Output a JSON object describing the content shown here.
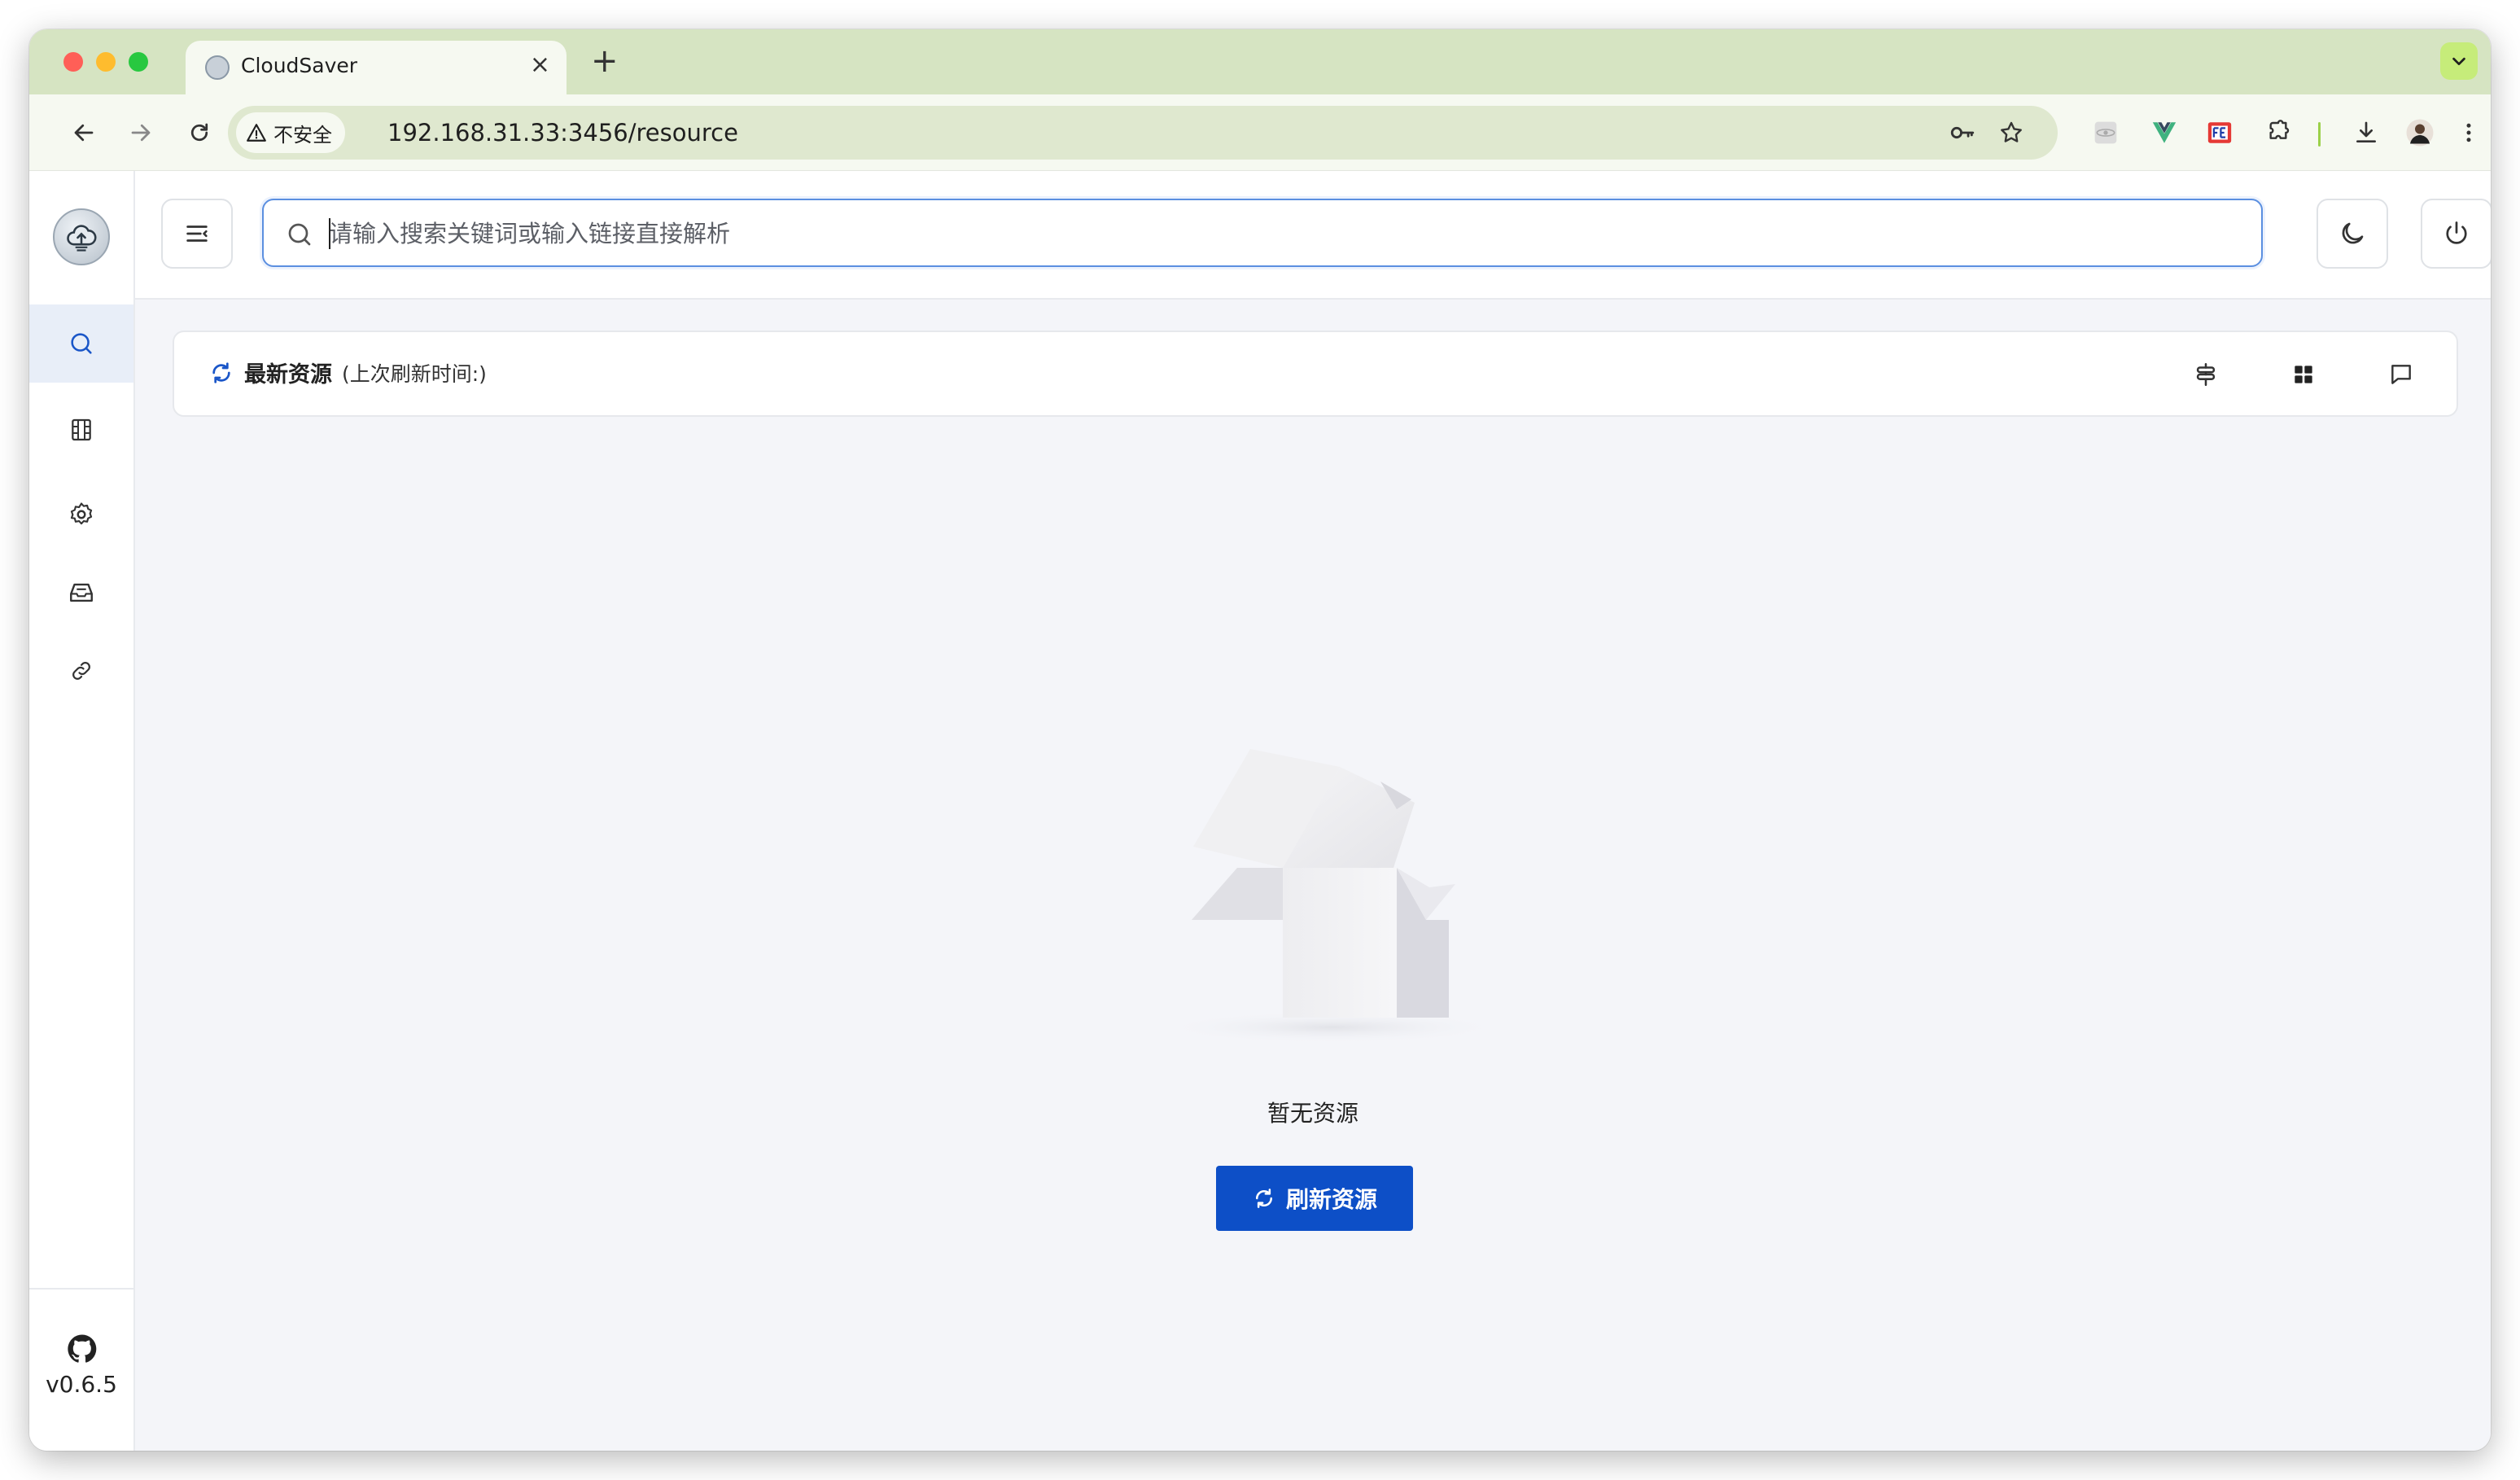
{
  "browser": {
    "tab_title": "CloudSaver",
    "tab_close": "×",
    "new_tab": "+",
    "security_label": "不安全",
    "url": "192.168.31.33:3456/resource"
  },
  "app": {
    "search": {
      "placeholder": "请输入搜索关键词或输入链接直接解析"
    },
    "panel": {
      "title": "最新资源",
      "subtitle": "(上次刷新时间:)"
    },
    "empty": {
      "message": "暂无资源",
      "refresh_label": "刷新资源"
    },
    "version": "v0.6.5",
    "colors": {
      "accent": "#0d4fc7",
      "tab_strip": "#d6e4c2",
      "omnibox": "#dfe8cf"
    }
  }
}
